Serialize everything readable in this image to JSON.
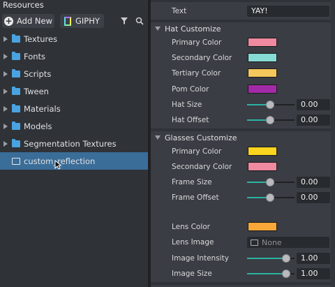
{
  "resources": {
    "title": "Resources",
    "add_new_label": "Add New",
    "giphy_label": "GIPHY",
    "folders": [
      {
        "label": "Textures"
      },
      {
        "label": "Fonts"
      },
      {
        "label": "Scripts"
      },
      {
        "label": "Tween"
      },
      {
        "label": "Materials"
      },
      {
        "label": "Models"
      },
      {
        "label": "Segmentation Textures"
      }
    ],
    "selected_item": {
      "label": "custom_reflection"
    }
  },
  "inspector": {
    "text": {
      "label": "Text",
      "value": "YAY!"
    },
    "hat_section": {
      "label": "Hat Customize",
      "primary_color": {
        "label": "Primary Color",
        "color": "#ef8aa0"
      },
      "secondary_color": {
        "label": "Secondary Color",
        "color": "#86dcd5"
      },
      "tertiary_color": {
        "label": "Tertiary Color",
        "color": "#f5c85c"
      },
      "pom_color": {
        "label": "Pom Color",
        "color": "#a32aa7"
      },
      "hat_size": {
        "label": "Hat Size",
        "value": "0.00",
        "fraction": 0.48
      },
      "hat_offset": {
        "label": "Hat Offset",
        "value": "0.00",
        "fraction": 0.48
      }
    },
    "glasses_section": {
      "label": "Glasses Customize",
      "primary_color": {
        "label": "Primary Color",
        "color": "#fbd41f"
      },
      "secondary_color": {
        "label": "Secondary Color",
        "color": "#ef8aa0"
      },
      "frame_size": {
        "label": "Frame Size",
        "value": "0.00",
        "fraction": 0.48
      },
      "frame_offset": {
        "label": "Frame Offset",
        "value": "0.00",
        "fraction": 0.48
      },
      "lens_color": {
        "label": "Lens Color",
        "color": "#f8a838"
      },
      "lens_image": {
        "label": "Lens Image",
        "value": "None"
      },
      "image_intensity": {
        "label": "Image Intensity",
        "value": "1.00",
        "fraction": 0.9
      },
      "image_size": {
        "label": "Image Size",
        "value": "1.00",
        "fraction": 0.9
      }
    }
  }
}
